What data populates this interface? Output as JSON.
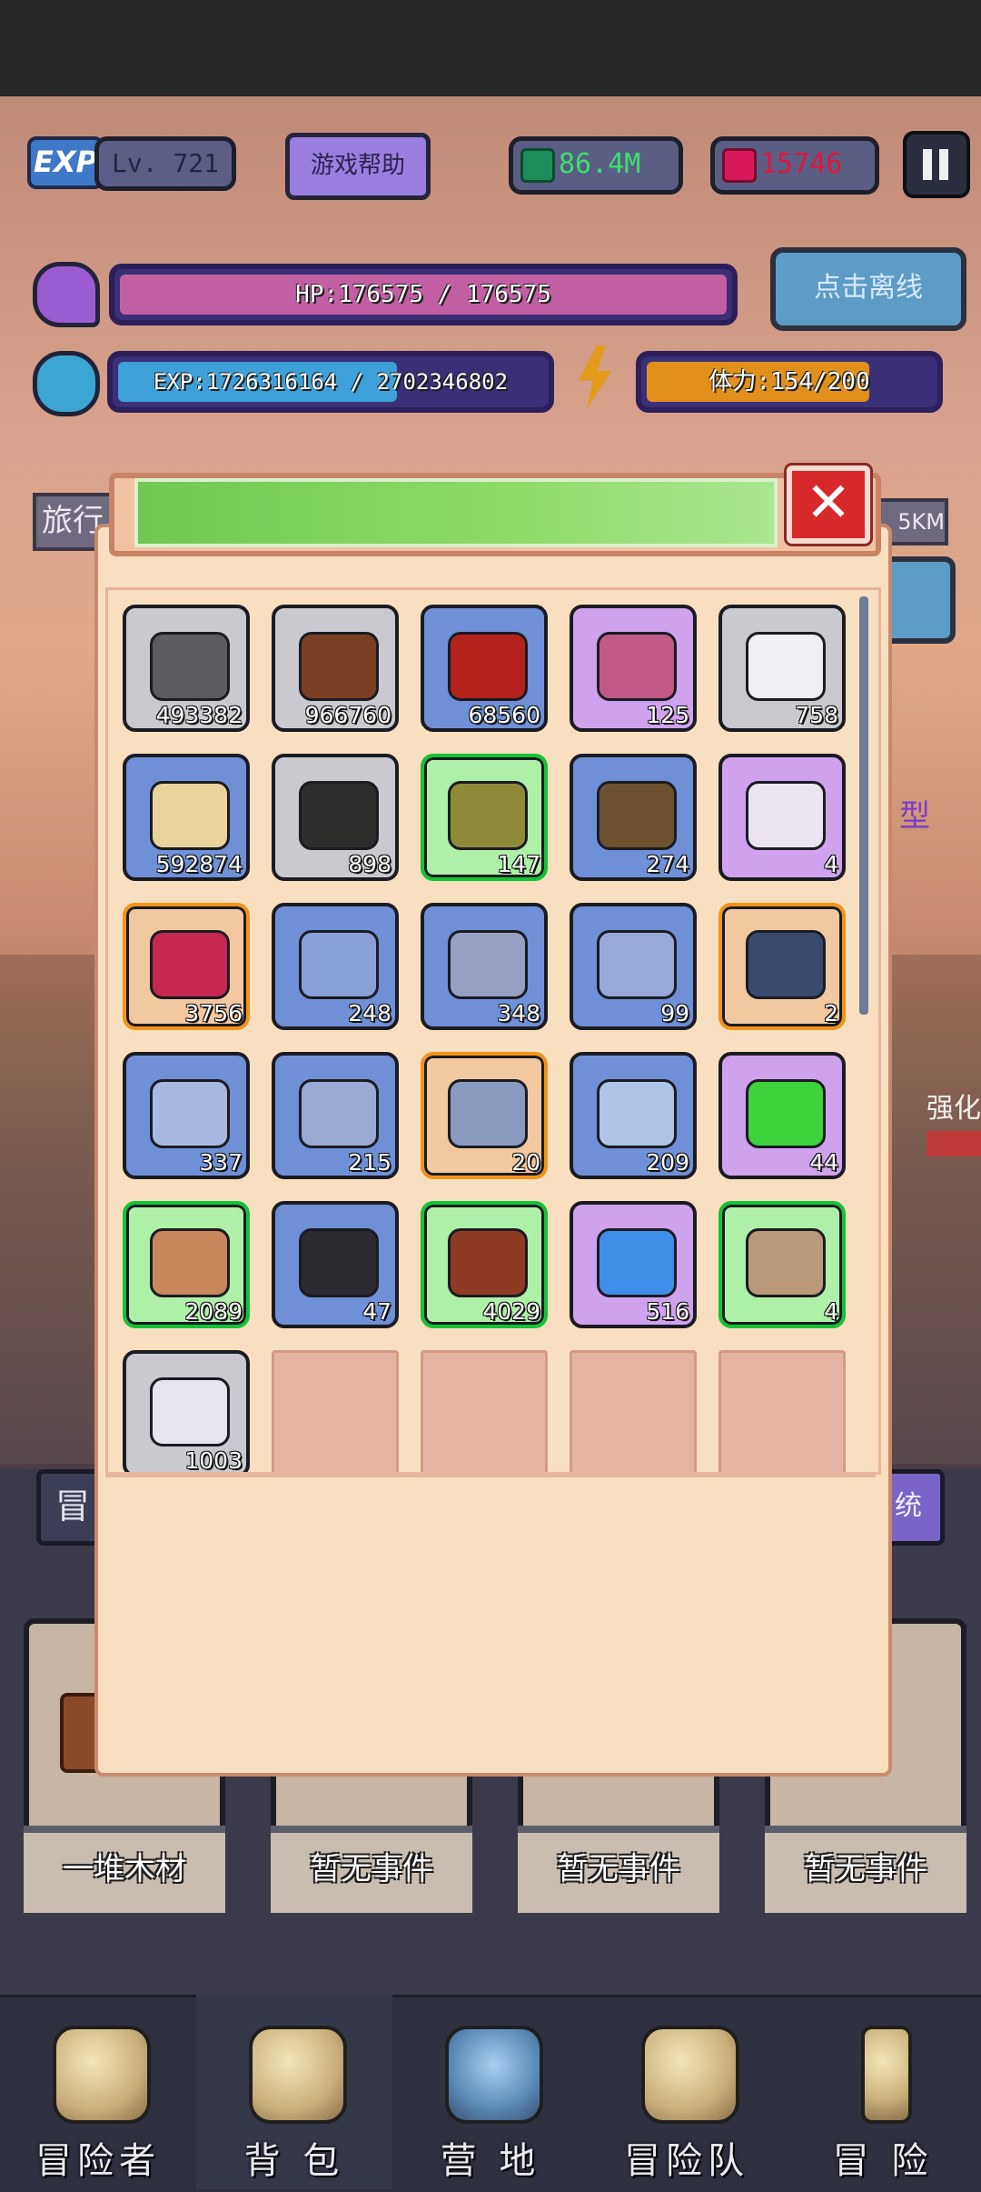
{
  "header": {
    "exp_badge": "EXP",
    "level": "Lv. 721",
    "help_button": "游戏帮助",
    "currency_green": "86.4M",
    "currency_red": "15746",
    "pause_icon": "pause-icon"
  },
  "bars": {
    "hp_text": "HP:176575 / 176575",
    "exp_text": "EXP:1726316164 / 2702346802",
    "stamina_text": "体力:154/200",
    "offline_button": "点击离线"
  },
  "background_peek": {
    "left_label": "旅行",
    "right_km": "5KM",
    "right_text": "型",
    "upgrade": "强化",
    "left_book": "冒",
    "right_system": "统"
  },
  "event_cards": [
    {
      "label": "一堆木材"
    },
    {
      "label": "暂无事件"
    },
    {
      "label": "暂无事件"
    },
    {
      "label": "暂无事件"
    }
  ],
  "inventory": {
    "title": "",
    "close_label": "✕",
    "items": [
      {
        "icon": "stone-ore-icon",
        "rarity": "gray",
        "count": "493382",
        "color": "#5c5c62"
      },
      {
        "icon": "wood-log-icon",
        "rarity": "gray",
        "count": "966760",
        "color": "#7a3f22"
      },
      {
        "icon": "red-ore-icon",
        "rarity": "blue",
        "count": "68560",
        "color": "#b5221e"
      },
      {
        "icon": "key-icon",
        "rarity": "purple",
        "count": "125",
        "color": "#c25a88"
      },
      {
        "icon": "white-stone-icon",
        "rarity": "gray",
        "count": "758",
        "color": "#f0f0f4"
      },
      {
        "icon": "cheese-block-icon",
        "rarity": "blue",
        "count": "592874",
        "color": "#e8d39a"
      },
      {
        "icon": "coal-icon",
        "rarity": "gray",
        "count": "898",
        "color": "#2e2e2c"
      },
      {
        "icon": "gold-ore-icon",
        "rarity": "green",
        "count": "147",
        "color": "#8f8a3a"
      },
      {
        "icon": "gold-nugget-icon",
        "rarity": "blue",
        "count": "274",
        "color": "#6c5230"
      },
      {
        "icon": "needle-icon",
        "rarity": "purple",
        "count": "4",
        "color": "#ece4f0"
      },
      {
        "icon": "meat-icon",
        "rarity": "orange",
        "count": "3756",
        "color": "#c62852"
      },
      {
        "icon": "ring-icon",
        "rarity": "blue",
        "count": "248",
        "color": "#8aa0d8"
      },
      {
        "icon": "helmet-icon",
        "rarity": "blue",
        "count": "348",
        "color": "#98a0c4"
      },
      {
        "icon": "armor-icon",
        "rarity": "blue",
        "count": "99",
        "color": "#98a8d8"
      },
      {
        "icon": "book-icon",
        "rarity": "orange",
        "count": "2",
        "color": "#3a4a6e"
      },
      {
        "icon": "sword-icon",
        "rarity": "blue",
        "count": "337",
        "color": "#a8b8e0"
      },
      {
        "icon": "cap-icon",
        "rarity": "blue",
        "count": "215",
        "color": "#9aa8d4"
      },
      {
        "icon": "scroll-icon",
        "rarity": "orange",
        "count": "20",
        "color": "#8a9ac0"
      },
      {
        "icon": "shield-icon",
        "rarity": "blue",
        "count": "209",
        "color": "#b0c4e8"
      },
      {
        "icon": "slime-icon",
        "rarity": "purple",
        "count": "44",
        "color": "#3ed23c"
      },
      {
        "icon": "map-scroll-icon",
        "rarity": "green",
        "count": "2089",
        "color": "#c9865a"
      },
      {
        "icon": "chest-icon",
        "rarity": "blue",
        "count": "47",
        "color": "#2a2a30"
      },
      {
        "icon": "brick-icon",
        "rarity": "green",
        "count": "4029",
        "color": "#8f3a24"
      },
      {
        "icon": "crystal-icon",
        "rarity": "purple",
        "count": "516",
        "color": "#3f8fe8"
      },
      {
        "icon": "wood-chest-icon",
        "rarity": "green",
        "count": "4",
        "color": "#b89a78"
      },
      {
        "icon": "silver-ore-icon",
        "rarity": "gray",
        "count": "1003",
        "color": "#e8e4f0"
      },
      {
        "icon": "",
        "rarity": "empty",
        "count": "",
        "color": ""
      },
      {
        "icon": "",
        "rarity": "empty",
        "count": "",
        "color": ""
      },
      {
        "icon": "",
        "rarity": "empty",
        "count": "",
        "color": ""
      },
      {
        "icon": "",
        "rarity": "empty",
        "count": "",
        "color": ""
      }
    ]
  },
  "nav": [
    {
      "label": "冒险者",
      "icon": "crown-icon"
    },
    {
      "label": "背 包",
      "icon": "backpack-icon"
    },
    {
      "label": "营 地",
      "icon": "camp-icon"
    },
    {
      "label": "冒险队",
      "icon": "team-icon"
    },
    {
      "label": "冒 险",
      "icon": "sword-icon"
    }
  ]
}
